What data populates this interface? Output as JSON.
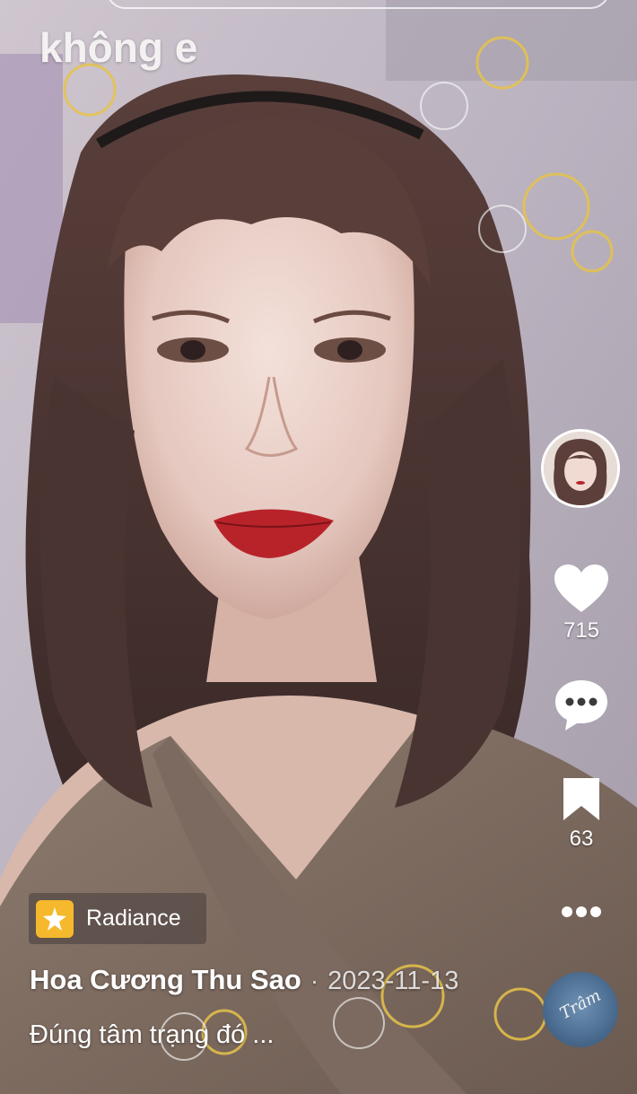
{
  "overlay": {
    "caption_text": "không e"
  },
  "creator": {
    "avatar": "creator-avatar-photo"
  },
  "actions": {
    "likes": "715",
    "bookmarks": "63",
    "icons": [
      "heart-icon",
      "comment-icon",
      "bookmark-icon",
      "more-icon"
    ]
  },
  "effect": {
    "label": "Radiance",
    "icon": "sparkle-icon",
    "color": "#f6b82c"
  },
  "post": {
    "author": "Hoa Cương Thu Sao",
    "separator": "·",
    "date": "2023-11-13",
    "description": "Đúng tâm trạng đó ..."
  },
  "music": {
    "disc_text": "Trâm"
  },
  "colors": {
    "text": "#ffffff",
    "wall": "#b8b0be",
    "lipstick": "#b8232a"
  }
}
